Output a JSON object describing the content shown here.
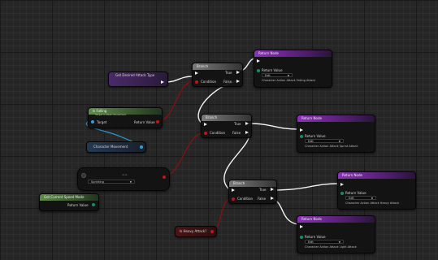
{
  "nodes": {
    "get_desired": {
      "title": "Get Desired Attack Type"
    },
    "is_falling": {
      "title": "Is Falling",
      "subtitle": "Target is Pawn Movement",
      "target_label": "Target",
      "return_label": "Return Value"
    },
    "character_movement": {
      "label": "Character Movement"
    },
    "switch_node": {
      "value": "Sprinting",
      "mid_label": "=="
    },
    "get_speed_mode": {
      "title": "Get Current Speed Mode",
      "return_label": "Return Value"
    },
    "is_heavy": {
      "label": "Is Heavy Attack?"
    },
    "branch1": {
      "title": "Branch",
      "true_label": "True",
      "false_label": "False",
      "condition_label": "Condition"
    },
    "branch2": {
      "title": "Branch",
      "true_label": "True",
      "false_label": "False",
      "condition_label": "Condition"
    },
    "branch3": {
      "title": "Branch",
      "true_label": "True",
      "false_label": "False",
      "condition_label": "Condition"
    },
    "return1": {
      "title": "Return Node",
      "return_value_label": "Return Value",
      "edit_label": "Edit",
      "value": "Character Action Attack Falling Attack"
    },
    "return2": {
      "title": "Return Node",
      "return_value_label": "Return Value",
      "edit_label": "Edit",
      "value": "Character Action Attack Sprint Attack"
    },
    "return3": {
      "title": "Return Node",
      "return_value_label": "Return Value",
      "edit_label": "Edit",
      "value": "Character Action Attack Heavy Attack"
    },
    "return4": {
      "title": "Return Node",
      "return_value_label": "Return Value",
      "edit_label": "Edit",
      "value": "Character Action Attack Light Attack"
    }
  },
  "colors": {
    "background": "#262626",
    "exec_wire": "#f2f2f2",
    "bool_wire": "#8e0f0f",
    "object_wire": "#2aa0d8",
    "purple_header": "#8a32b8",
    "green_header": "#5e8c4a",
    "gray_header": "#7a7a7a"
  }
}
